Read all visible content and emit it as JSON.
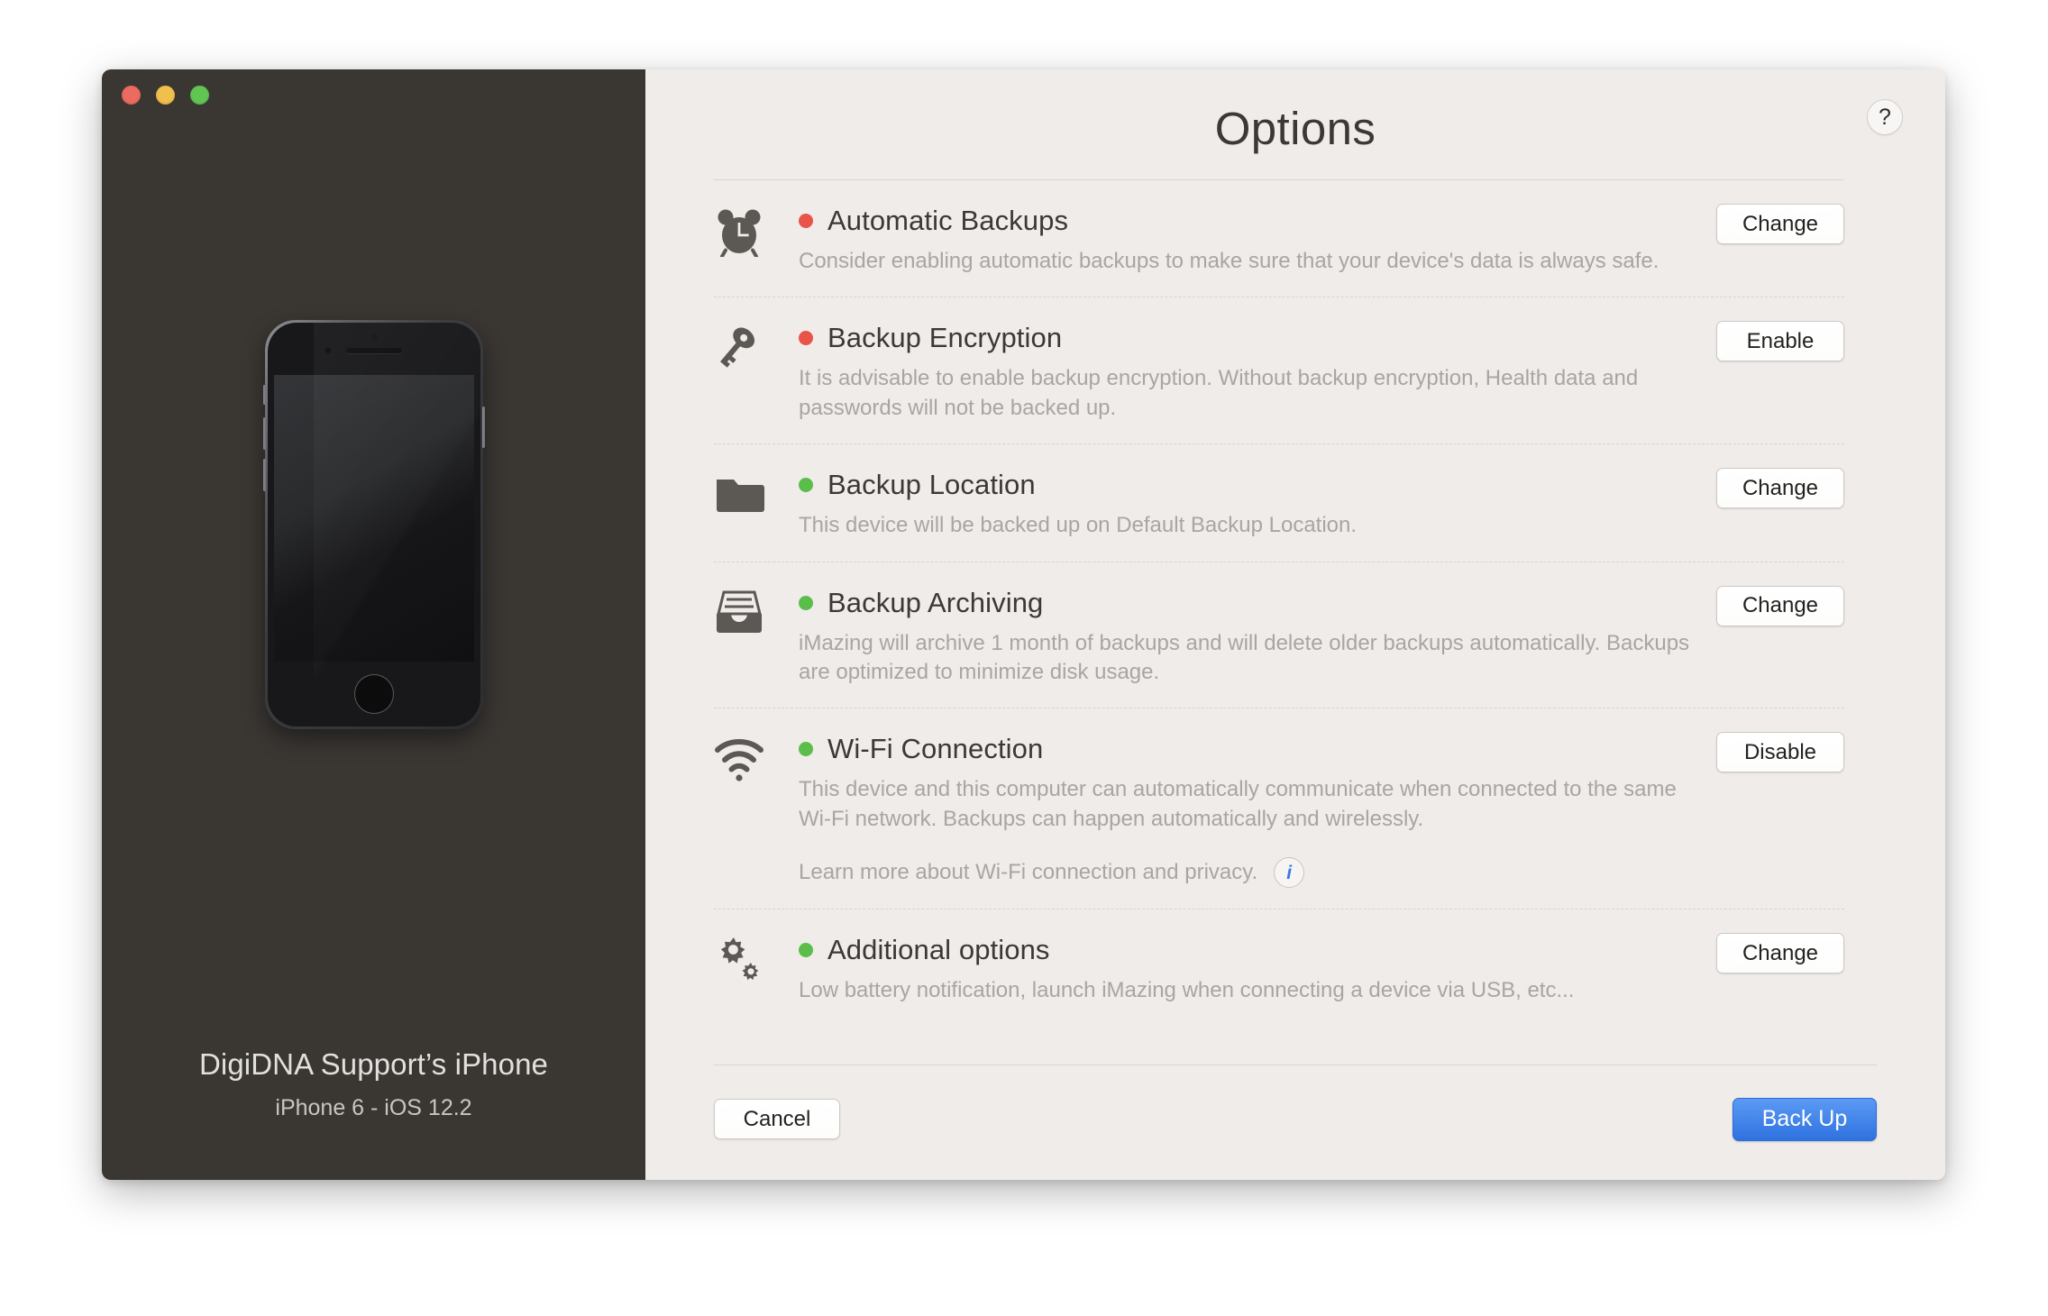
{
  "window": {
    "traffic_lights": [
      "close",
      "minimize",
      "maximize"
    ]
  },
  "sidebar": {
    "device_name": "DigiDNA Support’s iPhone",
    "device_subtitle": "iPhone 6 - iOS 12.2"
  },
  "header": {
    "title": "Options",
    "help_label": "?"
  },
  "colors": {
    "status_red": "#e85448",
    "status_green": "#5bbe4a",
    "accent_blue": "#3b78e7",
    "sidebar_bg": "#3a3733",
    "panel_bg": "#efecea"
  },
  "rows": [
    {
      "icon": "alarm-clock-icon",
      "status": "red",
      "title": "Automatic Backups",
      "description": "Consider enabling automatic backups to make sure that your device's data is always safe.",
      "action_label": "Change"
    },
    {
      "icon": "key-icon",
      "status": "red",
      "title": "Backup Encryption",
      "description": "It is advisable to enable backup encryption. Without backup encryption, Health data and passwords will not be backed up.",
      "action_label": "Enable"
    },
    {
      "icon": "folder-icon",
      "status": "green",
      "title": "Backup Location",
      "description": "This device will be backed up on Default Backup Location.",
      "action_label": "Change"
    },
    {
      "icon": "archive-tray-icon",
      "status": "green",
      "title": "Backup Archiving",
      "description": "iMazing will archive 1 month of backups and will delete older backups automatically. Backups are optimized to minimize disk usage.",
      "action_label": "Change"
    },
    {
      "icon": "wifi-icon",
      "status": "green",
      "title": "Wi-Fi Connection",
      "description": "This device and this computer can automatically communicate when connected to the same Wi-Fi network. Backups can happen automatically and wirelessly.",
      "link_text": "Learn more about Wi-Fi connection and privacy.",
      "info_label": "i",
      "action_label": "Disable"
    },
    {
      "icon": "gears-icon",
      "status": "green",
      "title": "Additional options",
      "description": "Low battery notification, launch iMazing when connecting a device via USB, etc...",
      "action_label": "Change"
    }
  ],
  "footer": {
    "cancel_label": "Cancel",
    "backup_label": "Back Up"
  }
}
